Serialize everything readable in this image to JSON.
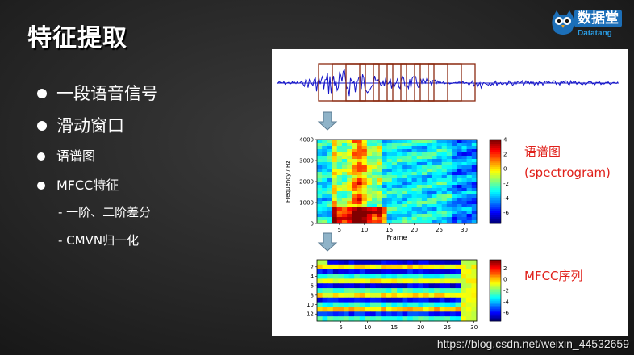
{
  "title": "特征提取",
  "logo": {
    "cn": "数据堂",
    "en": "Datatang"
  },
  "bullets": [
    {
      "text": "一段语音信号"
    },
    {
      "text": "滑动窗口"
    },
    {
      "text": "语谱图"
    },
    {
      "text": "MFCC特征"
    }
  ],
  "sub_bullets": [
    {
      "text": "- 一阶、二阶差分"
    },
    {
      "text": "- CMVN归一化"
    }
  ],
  "figure": {
    "spectrogram": {
      "label_cn": "语谱图",
      "label_en": "(spectrogram)",
      "ylabel": "Frequency / Hz",
      "xlabel": "Frame",
      "yticks": [
        "4000",
        "3000",
        "2000",
        "1000",
        "0"
      ],
      "xticks": [
        "5",
        "10",
        "15",
        "20",
        "25",
        "30"
      ],
      "cbar_ticks": [
        "4",
        "2",
        "0",
        "-2",
        "-4",
        "-6"
      ]
    },
    "mfcc": {
      "label": "MFCC序列",
      "yticks": [
        "2",
        "4",
        "6",
        "8",
        "10",
        "12"
      ],
      "xticks": [
        "5",
        "10",
        "15",
        "20",
        "25",
        "30"
      ],
      "cbar_ticks": [
        "2",
        "0",
        "-2",
        "-4",
        "-6"
      ]
    }
  },
  "watermark": "https://blog.csdn.net/weixin_44532659",
  "colors": {
    "waveform": "#1414c8",
    "window_box": "#8b2a10",
    "label_red": "#e0201a",
    "arrow": "#8fb3c8"
  }
}
